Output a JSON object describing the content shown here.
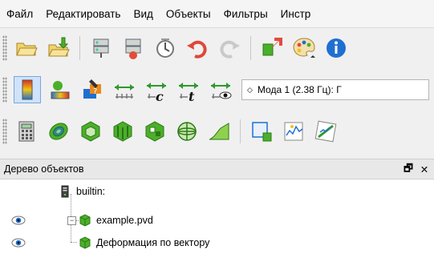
{
  "menu": [
    "Файл",
    "Редактировать",
    "Вид",
    "Объекты",
    "Фильтры",
    "Инстр"
  ],
  "toolbar1": {
    "icons": [
      "open-folder-icon",
      "load-state-icon",
      "connect-icon",
      "disconnect-icon",
      "reset-session-icon",
      "undo-icon",
      "redo-icon",
      "camera-reset-icon",
      "palette-icon",
      "help-icon"
    ]
  },
  "toolbar2": {
    "icons": [
      "color-map-icon",
      "color-legend-icon",
      "edit-colormap-icon",
      "rescale-range-icon",
      "rescale-custom-icon",
      "rescale-time-icon",
      "rescale-visible-icon"
    ],
    "mode_selector": "Мода 1 (2.38 Гц): Г"
  },
  "toolbar3": {
    "icons": [
      "calculator-icon",
      "contour-icon",
      "clip-icon",
      "slice-icon",
      "threshold-icon",
      "glyph-icon",
      "stream-tracer-icon",
      "extract-selection-icon",
      "plot-data-icon",
      "plot-over-line-icon"
    ]
  },
  "panel": {
    "title": "Дерево объектов",
    "float_glyph": "🗗",
    "close_glyph": "✕"
  },
  "tree": [
    {
      "label": "builtin:"
    },
    {
      "label": "example.pvd",
      "expander": "−"
    },
    {
      "label": "Деформация по вектору"
    }
  ],
  "colors": {
    "green_block": "#4caf2a",
    "orange": "#e98a1d",
    "blue": "#1f6fd1"
  }
}
